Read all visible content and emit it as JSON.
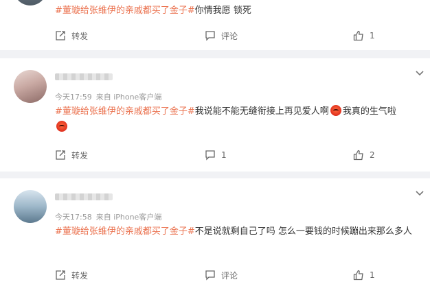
{
  "feed": {
    "items": [
      {
        "has_header": false,
        "segments": [
          {
            "type": "tag",
            "text": "#董璇给张维伊的亲戚都买了金子#"
          },
          {
            "type": "text",
            "text": "你情我愿 锁死"
          }
        ],
        "actions": {
          "repost": "转发",
          "comment": "评论",
          "like": "1"
        }
      },
      {
        "has_header": true,
        "time": "今天17:59",
        "source": "来自 iPhone客户端",
        "segments": [
          {
            "type": "tag",
            "text": "#董璇给张维伊的亲戚都买了金子#"
          },
          {
            "type": "text",
            "text": "我说能不能无缝衔接上再见爱人啊"
          },
          {
            "type": "emoji",
            "icon": "angry-face-icon"
          },
          {
            "type": "text",
            "text": "我真的生气啦"
          },
          {
            "type": "emoji",
            "icon": "angry-face-icon"
          }
        ],
        "actions": {
          "repost": "转发",
          "comment": "1",
          "like": "2"
        }
      },
      {
        "has_header": true,
        "time": "今天17:58",
        "source": "来自 iPhone客户端",
        "segments": [
          {
            "type": "tag",
            "text": "#董璇给张维伊的亲戚都买了金子#"
          },
          {
            "type": "text",
            "text": "不是说就剩自己了吗 怎么一要钱的时候蹦出来那么多人"
          }
        ],
        "actions": {
          "repost": "转发",
          "comment": "评论",
          "like": "1"
        }
      }
    ]
  },
  "colors": {
    "tag": "#eb7350",
    "meta": "#999999",
    "background": "#f1f2f5"
  },
  "icons": {
    "repost": "repost-icon",
    "comment": "comment-icon",
    "like": "thumbs-up-icon",
    "more": "chevron-down-icon"
  }
}
